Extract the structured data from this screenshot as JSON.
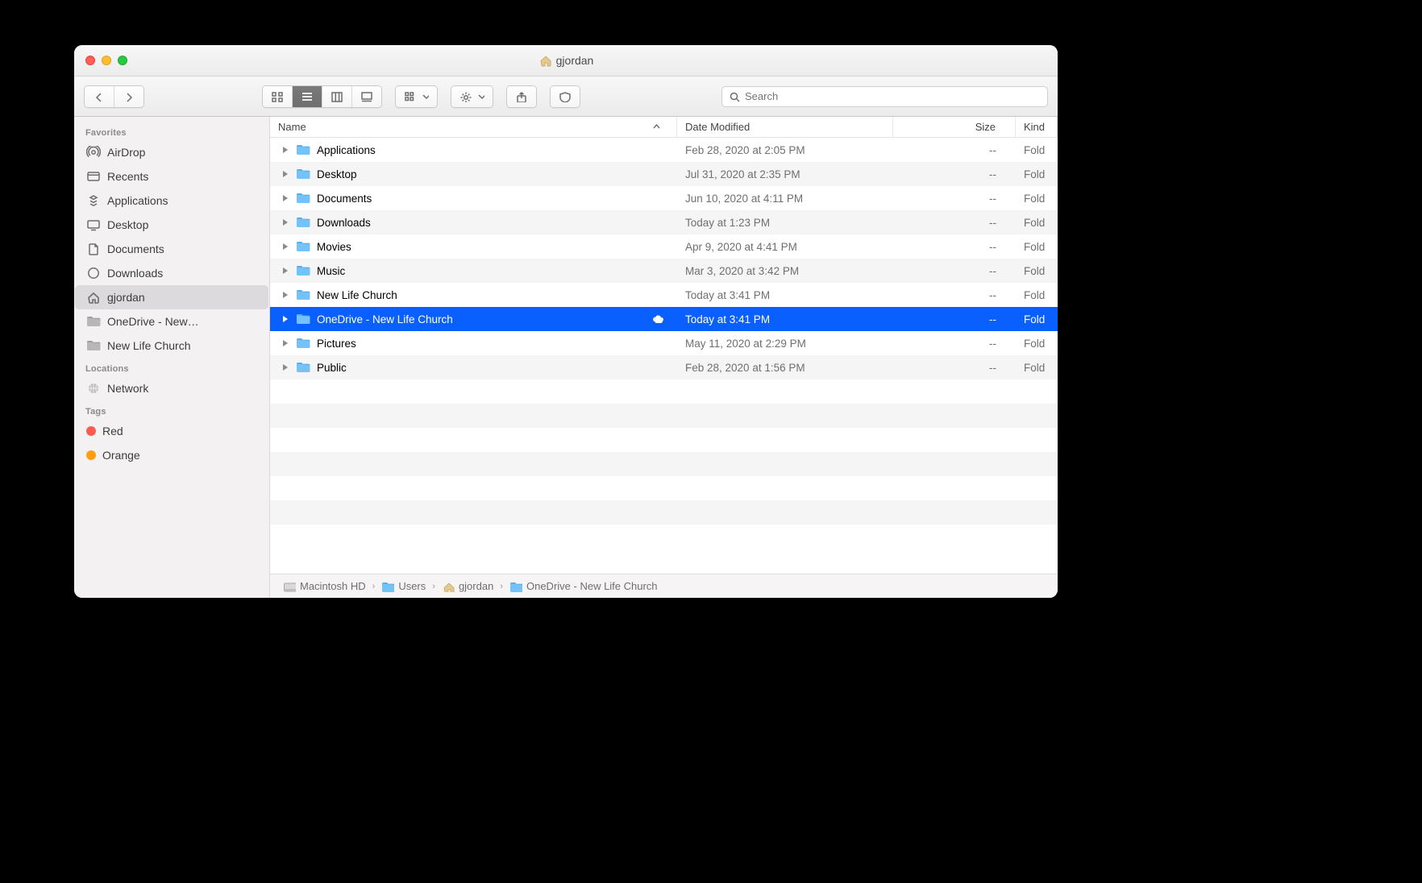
{
  "window": {
    "title": "gjordan"
  },
  "toolbar": {
    "search_placeholder": "Search"
  },
  "sidebar": {
    "sections": [
      {
        "title": "Favorites",
        "items": [
          {
            "label": "AirDrop",
            "icon": "airdrop"
          },
          {
            "label": "Recents",
            "icon": "recents"
          },
          {
            "label": "Applications",
            "icon": "apps"
          },
          {
            "label": "Desktop",
            "icon": "desktop"
          },
          {
            "label": "Documents",
            "icon": "documents"
          },
          {
            "label": "Downloads",
            "icon": "downloads"
          },
          {
            "label": "gjordan",
            "icon": "home",
            "selected": true
          },
          {
            "label": "OneDrive - New…",
            "icon": "folder-gray"
          },
          {
            "label": "New Life Church",
            "icon": "folder-gray"
          }
        ]
      },
      {
        "title": "Locations",
        "items": [
          {
            "label": "Network",
            "icon": "network"
          }
        ]
      },
      {
        "title": "Tags",
        "items": [
          {
            "label": "Red",
            "icon": "tag",
            "color": "#ff5b52"
          },
          {
            "label": "Orange",
            "icon": "tag",
            "color": "#ff9f0a"
          }
        ]
      }
    ]
  },
  "columns": {
    "name": "Name",
    "date": "Date Modified",
    "size": "Size",
    "kind": "Kind"
  },
  "rows": [
    {
      "name": "Applications",
      "date": "Feb 28, 2020 at 2:05 PM",
      "size": "--",
      "kind": "Fold"
    },
    {
      "name": "Desktop",
      "date": "Jul 31, 2020 at 2:35 PM",
      "size": "--",
      "kind": "Fold"
    },
    {
      "name": "Documents",
      "date": "Jun 10, 2020 at 4:11 PM",
      "size": "--",
      "kind": "Fold"
    },
    {
      "name": "Downloads",
      "date": "Today at 1:23 PM",
      "size": "--",
      "kind": "Fold"
    },
    {
      "name": "Movies",
      "date": "Apr 9, 2020 at 4:41 PM",
      "size": "--",
      "kind": "Fold"
    },
    {
      "name": "Music",
      "date": "Mar 3, 2020 at 3:42 PM",
      "size": "--",
      "kind": "Fold"
    },
    {
      "name": "New Life Church",
      "date": "Today at 3:41 PM",
      "size": "--",
      "kind": "Fold"
    },
    {
      "name": "OneDrive - New Life Church",
      "date": "Today at 3:41 PM",
      "size": "--",
      "kind": "Fold",
      "selected": true,
      "cloud": true
    },
    {
      "name": "Pictures",
      "date": "May 11, 2020 at 2:29 PM",
      "size": "--",
      "kind": "Fold"
    },
    {
      "name": "Public",
      "date": "Feb 28, 2020 at 1:56 PM",
      "size": "--",
      "kind": "Fold"
    }
  ],
  "path": [
    {
      "label": "Macintosh HD",
      "icon": "disk"
    },
    {
      "label": "Users",
      "icon": "folder"
    },
    {
      "label": "gjordan",
      "icon": "home"
    },
    {
      "label": "OneDrive - New Life Church",
      "icon": "folder"
    }
  ],
  "colors": {
    "selection": "#0a60ff",
    "folder": "#74c2f7"
  }
}
